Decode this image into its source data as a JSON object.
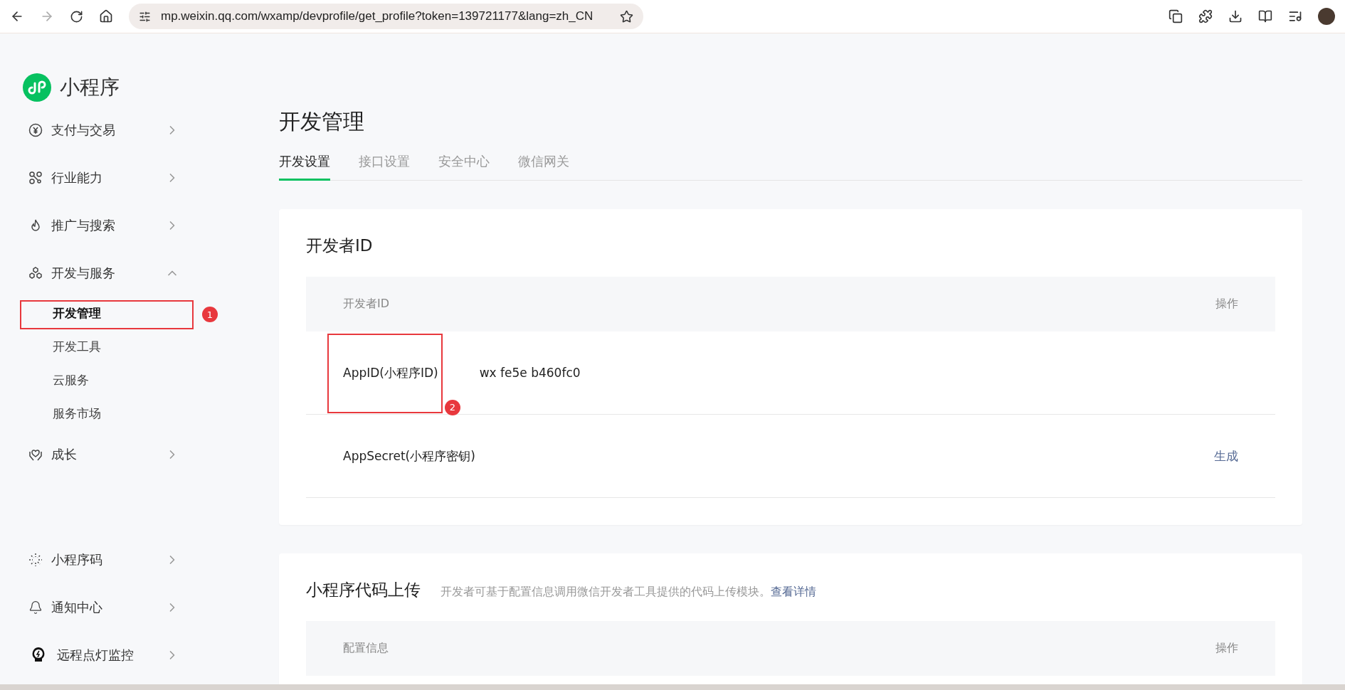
{
  "browser": {
    "url": "mp.weixin.qq.com/wxamp/devprofile/get_profile?token=139721177&lang=zh_CN"
  },
  "sidebar": {
    "brand": "小程序",
    "groups": [
      {
        "label": "支付与交易",
        "expanded": false
      },
      {
        "label": "行业能力",
        "expanded": false
      },
      {
        "label": "推广与搜索",
        "expanded": false
      },
      {
        "label": "开发与服务",
        "expanded": true,
        "children": [
          {
            "label": "开发管理",
            "selected": true,
            "annotation": "1"
          },
          {
            "label": "开发工具",
            "selected": false
          },
          {
            "label": "云服务",
            "selected": false
          },
          {
            "label": "服务市场",
            "selected": false
          }
        ]
      },
      {
        "label": "成长",
        "expanded": false
      }
    ],
    "bottom": [
      {
        "label": "小程序码"
      },
      {
        "label": "通知中心"
      },
      {
        "label": "远程点灯监控"
      }
    ]
  },
  "page": {
    "title": "开发管理",
    "tabs": [
      {
        "label": "开发设置",
        "selected": true
      },
      {
        "label": "接口设置",
        "selected": false
      },
      {
        "label": "安全中心",
        "selected": false
      },
      {
        "label": "微信网关",
        "selected": false
      }
    ],
    "developer_id": {
      "title": "开发者ID",
      "columns": [
        "开发者ID",
        "操作"
      ],
      "rows": [
        {
          "label": "AppID(小程序ID)",
          "annotation": "2",
          "value_parts": [
            "wx",
            "fe5e",
            "b460fc0"
          ]
        },
        {
          "label": "AppSecret(小程序密钥)",
          "action": "生成"
        }
      ]
    },
    "code_upload": {
      "title": "小程序代码上传",
      "description": "开发者可基于配置信息调用微信开发者工具提供的代码上传模块。",
      "link": "查看详情",
      "columns": [
        "配置信息",
        "操作"
      ]
    }
  }
}
